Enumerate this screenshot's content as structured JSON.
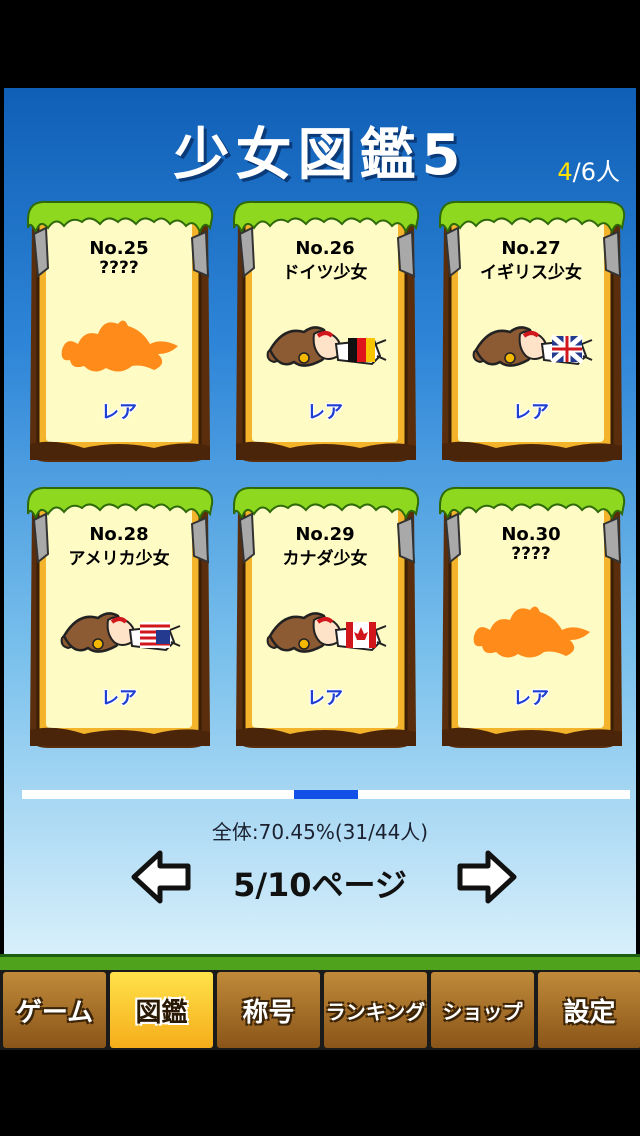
{
  "header": {
    "title": "少女図鑑5",
    "count_current": "4",
    "count_total": "/6人"
  },
  "cards": [
    {
      "no": "No.25",
      "name": "????",
      "rarity": "レア",
      "unlocked": false,
      "flag": "none"
    },
    {
      "no": "No.26",
      "name": "ドイツ少女",
      "rarity": "レア",
      "unlocked": true,
      "flag": "germany"
    },
    {
      "no": "No.27",
      "name": "イギリス少女",
      "rarity": "レア",
      "unlocked": true,
      "flag": "uk"
    },
    {
      "no": "No.28",
      "name": "アメリカ少女",
      "rarity": "レア",
      "unlocked": true,
      "flag": "usa"
    },
    {
      "no": "No.29",
      "name": "カナダ少女",
      "rarity": "レア",
      "unlocked": true,
      "flag": "canada"
    },
    {
      "no": "No.30",
      "name": "????",
      "rarity": "レア",
      "unlocked": false,
      "flag": "none"
    }
  ],
  "progress": {
    "page_fraction": 0.5,
    "total_text": "全体:70.45%(31/44人)"
  },
  "pager": {
    "label": "5/10ページ",
    "prev_icon": "left-arrow-icon",
    "next_icon": "right-arrow-icon"
  },
  "tabs": [
    {
      "label": "ゲーム",
      "active": false
    },
    {
      "label": "図鑑",
      "active": true
    },
    {
      "label": "称号",
      "active": false
    },
    {
      "label": "ランキング",
      "active": false
    },
    {
      "label": "ショップ",
      "active": false
    },
    {
      "label": "設定",
      "active": false
    }
  ],
  "colors": {
    "sky_top": "#0f5fb6",
    "progress_fill": "#1250e8",
    "tab_active": "#ffe24a",
    "tab_normal": "#a86f2a",
    "silhouette": "#ff8c1a"
  }
}
